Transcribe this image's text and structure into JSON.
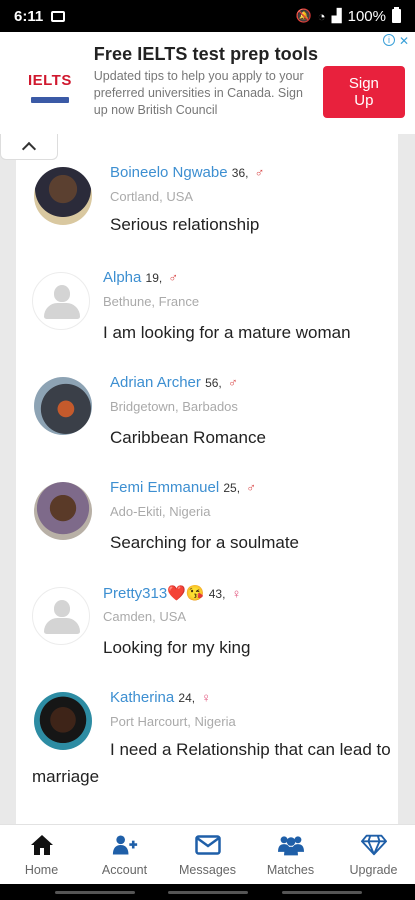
{
  "status": {
    "time": "6:11",
    "battery": "100%"
  },
  "ad": {
    "logo": "IELTS",
    "title": "Free IELTS test prep tools",
    "description": "Updated tips to help you apply to your preferred universities in Canada. Sign up now British Council",
    "cta": "Sign Up",
    "info_icon": "info-icon",
    "close_icon": "close-icon"
  },
  "profiles": [
    {
      "name": "Boineelo Ngwabe",
      "age": "36",
      "gender": "♂",
      "location": "Cortland, USA",
      "message": "Serious relationship",
      "avatar": "photo"
    },
    {
      "name": "Alpha",
      "age": "19",
      "gender": "♂",
      "location": "Bethune, France",
      "message": "I am looking for a mature woman",
      "avatar": "placeholder"
    },
    {
      "name": "Adrian Archer",
      "age": "56",
      "gender": "♂",
      "location": "Bridgetown, Barbados",
      "message": "Caribbean Romance",
      "avatar": "photo"
    },
    {
      "name": "Femi Emmanuel",
      "age": "25",
      "gender": "♂",
      "location": "Ado-Ekiti, Nigeria",
      "message": "Searching for a soulmate",
      "avatar": "photo"
    },
    {
      "name": "Pretty313❤️😘",
      "age": "43",
      "gender": "♀",
      "location": "Camden, USA",
      "message": "Looking for my king",
      "avatar": "placeholder"
    },
    {
      "name": "Katherina",
      "age": "24",
      "gender": "♀",
      "location": "Port Harcourt, Nigeria",
      "message": "I need a Relationship that can lead to marriage",
      "avatar": "photo"
    }
  ],
  "nav": [
    {
      "label": "Home",
      "icon": "home-icon"
    },
    {
      "label": "Account",
      "icon": "add-user-icon"
    },
    {
      "label": "Messages",
      "icon": "envelope-icon"
    },
    {
      "label": "Matches",
      "icon": "group-icon"
    },
    {
      "label": "Upgrade",
      "icon": "diamond-icon"
    }
  ],
  "colors": {
    "accent": "#3d8fd1",
    "nav_icon": "#1f5fa8",
    "ad_button": "#e8213d"
  }
}
